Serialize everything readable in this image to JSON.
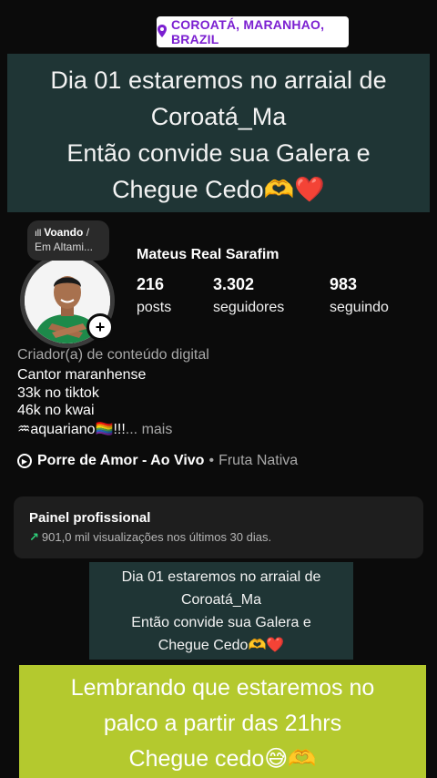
{
  "location": {
    "icon": "location-pin-icon",
    "label": "COROATÁ, MARANHAO, BRAZIL",
    "color": "#7b1fd1"
  },
  "banner_top": {
    "lines": [
      "Dia 01 estaremos no arraial de",
      "Coroatá_Ma",
      "Então convide sua Galera e",
      "Chegue Cedo🫶❤️"
    ]
  },
  "note": {
    "title": "Voando",
    "title_suffix": "/",
    "subtitle": "Em Altami..."
  },
  "profile": {
    "name": "Mateus Real Sarafim",
    "stats": [
      {
        "value": "216",
        "label": "posts"
      },
      {
        "value": "3.302",
        "label": "seguidores"
      },
      {
        "value": "983",
        "label": "seguindo"
      }
    ],
    "category": "Criador(a) de conteúdo digital",
    "bio": [
      "Cantor maranhense",
      "33k no tiktok",
      "46k no kwai"
    ],
    "bio_last": "♒aquariano🏳️‍🌈!!!",
    "bio_more": "... mais"
  },
  "music": {
    "song": "Porre de Amor - Ao Vivo",
    "separator": "•",
    "artist": "Fruta Nativa"
  },
  "pro_panel": {
    "title": "Painel profissional",
    "stats": "901,0 mil visualizações nos últimos 30 dias.",
    "accent": "#2fd17a"
  },
  "banner_mid": {
    "lines": [
      "Dia 01 estaremos no arraial de",
      "Coroatá_Ma",
      "Então convide sua Galera e",
      "Chegue Cedo🫶❤️"
    ]
  },
  "banner_bottom": {
    "lines": [
      "Lembrando que estaremos no",
      "palco a partir das 21hrs",
      "Chegue cedo😅🫶"
    ],
    "background": "#b4c92e"
  }
}
